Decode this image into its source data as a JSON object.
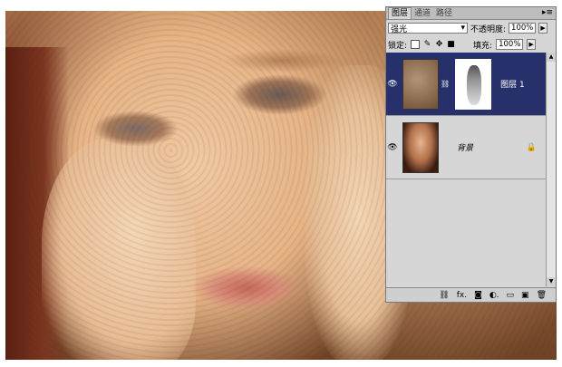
{
  "panel": {
    "tabs": [
      "图层",
      "通道",
      "路径"
    ],
    "menu_icon": "panel-menu-icon",
    "blend_mode": "强光",
    "opacity_label": "不透明度:",
    "opacity_value": "100%",
    "lock_label": "锁定:",
    "fill_label": "填充:",
    "fill_value": "100%",
    "layers": [
      {
        "name": "图层 1",
        "selected": true,
        "has_mask": true
      },
      {
        "name": "背景",
        "selected": false,
        "locked": true
      }
    ],
    "bottom_icons": [
      "link-icon",
      "fx-icon",
      "mask-icon",
      "adjustment-icon",
      "folder-icon",
      "new-layer-icon",
      "trash-icon"
    ]
  }
}
